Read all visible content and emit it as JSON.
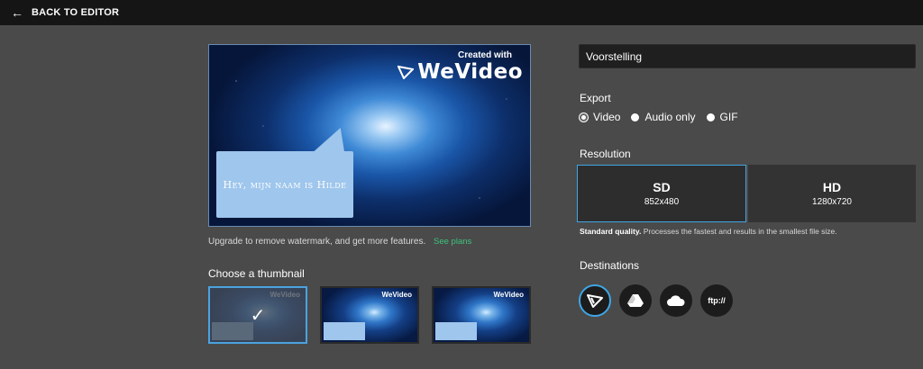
{
  "topbar": {
    "back_icon": "arrow-left-icon",
    "back_label": "BACK TO EDITOR"
  },
  "preview": {
    "watermark_created": "Created with",
    "watermark_logo": "WeVideo",
    "bubble_text": "Hey, mijn naam is Hilde"
  },
  "upgrade": {
    "text": "Upgrade to remove watermark, and get more features.",
    "link": "See plans"
  },
  "thumbnails": {
    "title": "Choose a thumbnail",
    "selected_index": 0
  },
  "title_input": {
    "value": "Voorstelling"
  },
  "export": {
    "label": "Export",
    "options": [
      "Video",
      "Audio only",
      "GIF"
    ],
    "selected": "Video"
  },
  "resolution": {
    "label": "Resolution",
    "options": [
      {
        "name": "SD",
        "size": "852x480"
      },
      {
        "name": "HD",
        "size": "1280x720"
      }
    ],
    "selected": "SD",
    "desc_bold": "Standard quality.",
    "desc_rest": " Processes the fastest and results in the smallest file size."
  },
  "destinations": {
    "label": "Destinations",
    "ftp_label": "ftp://",
    "icons": [
      "wevideo-icon",
      "google-drive-icon",
      "onedrive-icon",
      "ftp-icon"
    ],
    "selected": "wevideo-icon"
  },
  "colors": {
    "accent": "#3fa6e6",
    "link": "#3cc47c",
    "background": "#4a4a4a",
    "topbar": "#151515"
  }
}
